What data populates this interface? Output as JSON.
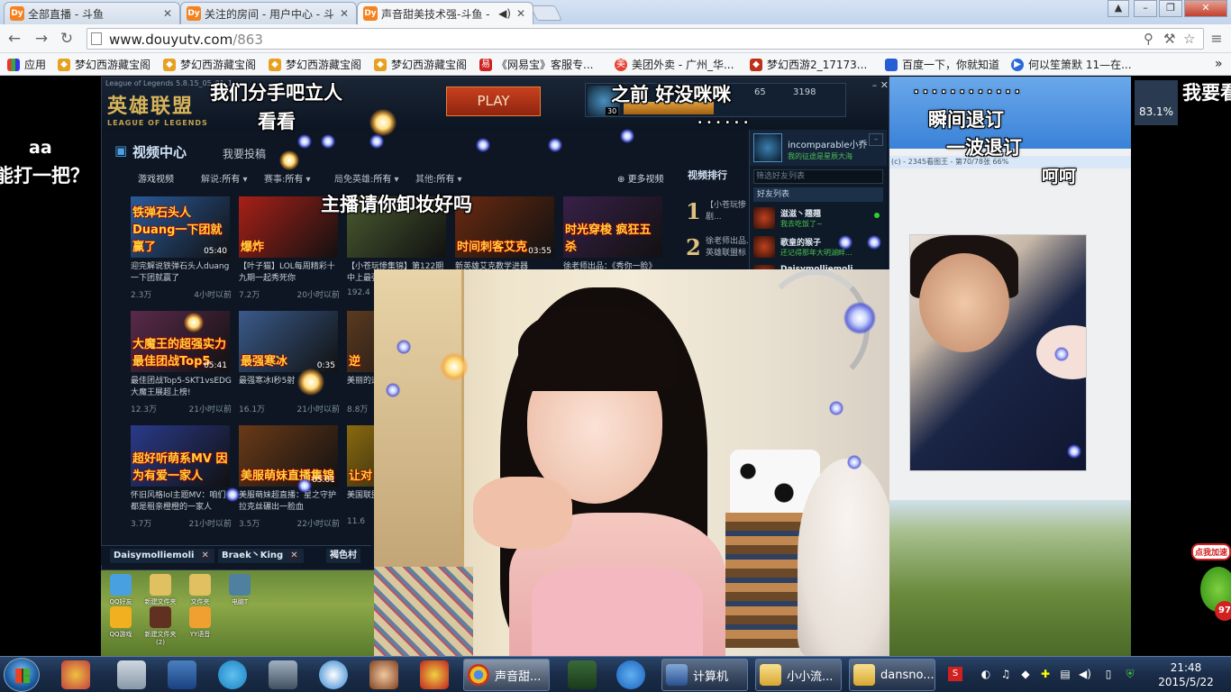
{
  "browser": {
    "tabs": [
      {
        "title": "全部直播 - 斗鱼",
        "favicon": "Dy"
      },
      {
        "title": "关注的房间 - 用户中心 - 斗",
        "favicon": "Dy"
      },
      {
        "title": "声音甜美技术强-斗鱼 -",
        "favicon": "Dy",
        "active": true
      }
    ],
    "url_host": "www.douyutv.com",
    "url_path": "/863",
    "bookmarks": [
      {
        "label": "应用",
        "icon": "apps-icon"
      },
      {
        "label": "梦幻西游藏宝阁",
        "icon": "cbg-icon"
      },
      {
        "label": "梦幻西游藏宝阁",
        "icon": "cbg-icon"
      },
      {
        "label": "梦幻西游藏宝阁",
        "icon": "cbg-icon"
      },
      {
        "label": "梦幻西游藏宝阁",
        "icon": "cbg-icon"
      },
      {
        "label": "《网易宝》客服专...",
        "icon": "netease-icon"
      },
      {
        "label": "美团外卖 - 广州_华...",
        "icon": "meituan-icon"
      },
      {
        "label": "梦幻西游2_17173...",
        "icon": "game-icon"
      },
      {
        "label": "百度一下，你就知道",
        "icon": "baidu-icon"
      },
      {
        "label": "何以笙箫默 11—在...",
        "icon": "play-icon"
      }
    ]
  },
  "lol_client": {
    "version": "League of Legends 5.8.15_05_01_1",
    "logo": "英雄联盟",
    "logo_sub": "LEAGUE OF LEGENDS",
    "play": "PLAY",
    "level": "30",
    "ip": "65",
    "rp": "3198",
    "section_title": "视频中心",
    "upload": "我要投稿",
    "filters": [
      {
        "label": "游戏视频",
        "value": ""
      },
      {
        "label": "解说:",
        "value": "所有"
      },
      {
        "label": "赛事:",
        "value": "所有"
      },
      {
        "label": "局免英雄:",
        "value": "所有"
      },
      {
        "label": "其他:",
        "value": "所有"
      }
    ],
    "more_videos": "更多视频",
    "ranking_title": "视频排行",
    "ranking": [
      {
        "num": "1",
        "text": "【小苍玩惨剧...",
        "sub": "小苍"
      },
      {
        "num": "2",
        "text": "徐老师出品...",
        "sub": "英雄联盟标准..."
      }
    ],
    "videos": [
      {
        "caption": "铁弹石头人Duang一下团就赢了",
        "duration": "05:40",
        "title": "迎完解说铁弹石头人duang一下团就赢了",
        "views": "2.3万",
        "time": "4小时以前",
        "color": "#2a5a9a"
      },
      {
        "caption": "爆炸",
        "duration": "",
        "title": "【叶子猫】LOL每周精彩十九期一起秀死你",
        "views": "7.2万",
        "time": "20小时以前",
        "color": "#a82018"
      },
      {
        "caption": "",
        "duration": "",
        "title": "【小苍玩惨集锦】第122期中上最强操...",
        "views": "192.4",
        "time": "",
        "color": "#4a5a30"
      },
      {
        "caption": "时间刺客艾克",
        "duration": "03:55",
        "title": "新英雄艾克教学进器",
        "views": "",
        "time": "",
        "color": "#6a2a10"
      },
      {
        "caption": "时光穿梭 疯狂五杀",
        "duration": "",
        "title": "徐老师出品：《秀你一脸》第",
        "views": "",
        "time": "",
        "color": "#382048"
      },
      {
        "caption": "大魔王的超强实力 最佳团战Top5",
        "duration": "05:41",
        "title": "最佳团战Top5-SKT1vsEDG大魔王展超上榜!",
        "views": "12.3万",
        "time": "21小时以前",
        "color": "#5a2a4a"
      },
      {
        "caption": "最强寒冰",
        "duration": "0:35",
        "title": "最强寒冰I秒5射",
        "views": "16.1万",
        "time": "21小时以前",
        "color": "#3a5a8a"
      },
      {
        "caption": "逆",
        "duration": "",
        "title": "美丽的运气",
        "views": "8.8万",
        "time": "",
        "color": "#5a3a20"
      },
      {
        "caption": "超好听萌系MV 因为有爱一家人",
        "duration": "",
        "title": "怀旧风格lol主题MV：咱们都是租亲橙橙的一家人",
        "views": "3.7万",
        "time": "21小时以前",
        "color": "#2a3a8a"
      },
      {
        "caption": "美服萌妹直播集锦",
        "duration": "05:01",
        "title": "美服萌妹超直播：星之守护拉克丝碾出一脸血",
        "views": "3.5万",
        "time": "22小时以前",
        "color": "#6a3a18"
      },
      {
        "caption": "让对 五击",
        "duration": "",
        "title": "美国联盟",
        "views": "11.6",
        "time": "",
        "color": "#8a6a10"
      }
    ],
    "friend_panel": {
      "name": "incomparable小乔",
      "status": "我的征途是星辰大海",
      "search_placeholder": "筛选好友列表",
      "list_title": "好友列表",
      "friends": [
        {
          "name": "滋滋丶翘翘",
          "status": "我去吃饭了~"
        },
        {
          "name": "歌皇的猴子",
          "status": "还记得那年大明湖畔..."
        },
        {
          "name": "Daisymolliemoli",
          "status": ""
        }
      ]
    },
    "dock": [
      {
        "name": "Daisymolliemoli"
      },
      {
        "name": "Braek丶King"
      },
      {
        "name": "褐色村"
      }
    ]
  },
  "desktop_icons": [
    "QQ好友",
    "新建文件夹",
    "文件夹",
    "电脑T",
    "QQ游戏",
    "新建文件夹 (2)",
    "YY语音"
  ],
  "right_panel": {
    "inner_title": "(c) - 2345看图王 - 第70/78张 66%",
    "percent": "83.1%"
  },
  "speed_ball": {
    "label": "点我加速",
    "value": "97"
  },
  "danmaku": [
    {
      "text": "我们分手吧立人",
      "color": "#ffffff"
    },
    {
      "text": "看看",
      "color": "#ffffff"
    },
    {
      "text": "之前  好没咪咪",
      "color": "#ffffff"
    },
    {
      "text": "aa",
      "color": "#ffffff"
    },
    {
      "text": "能打一把？",
      "color": "#ffffff"
    },
    {
      "text": "主播请你卸妆好吗",
      "color": "#ffffff"
    },
    {
      "text": "瞬间退订",
      "color": "#ffffff"
    },
    {
      "text": "一波退订",
      "color": "#ffffff"
    },
    {
      "text": "呵呵",
      "color": "#ffffff"
    },
    {
      "text": "我要看",
      "color": "#ffffff"
    },
    {
      "text": ". . . . . . . . . . . .",
      "color": "#ffffff"
    },
    {
      "text": ". . . . . .",
      "color": "#ffffff"
    }
  ],
  "taskbar": {
    "buttons": [
      {
        "label": "声音甜...",
        "icon": "chrome-icon"
      },
      {
        "label": "计算机",
        "icon": "computer-icon"
      },
      {
        "label": "小小流...",
        "icon": "folder-icon"
      },
      {
        "label": "dansno...",
        "icon": "folder-icon"
      }
    ],
    "time": "21:48",
    "date": "2015/5/22"
  }
}
